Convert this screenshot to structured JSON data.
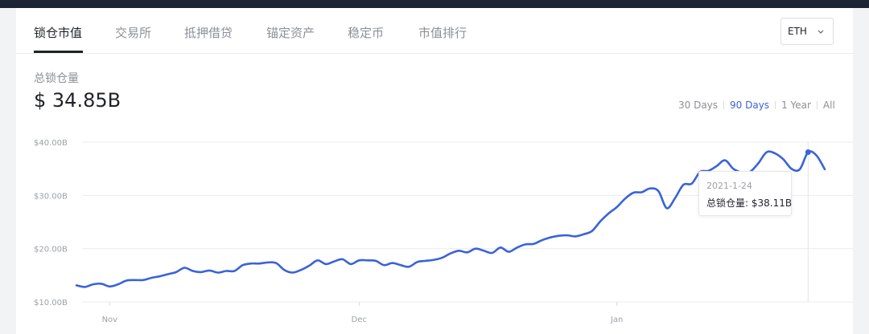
{
  "tabs": [
    "锁仓市值",
    "交易所",
    "抵押借贷",
    "锚定资产",
    "稳定币",
    "市值排行"
  ],
  "currency_select": {
    "value": "ETH"
  },
  "stat": {
    "label": "总锁仓量",
    "value": "$ 34.85B"
  },
  "ranges": [
    "30 Days",
    "90 Days",
    "1 Year",
    "All"
  ],
  "active_range": "90 Days",
  "tooltip": {
    "date": "2021-1-24",
    "label": "总锁仓量:",
    "value": "$38.11B"
  },
  "colors": {
    "line": "#3a63d8",
    "active": "#3a63d8",
    "text": "#1f2329",
    "muted": "#8b8f97"
  },
  "chart_data": {
    "type": "line",
    "x_unit": "date",
    "y_unit": "USD billions",
    "ylim": [
      10,
      40
    ],
    "y_ticks": [
      {
        "value": 10,
        "label": "$10.00B"
      },
      {
        "value": 20,
        "label": "$20.00B"
      },
      {
        "value": 30,
        "label": "$30.00B"
      },
      {
        "value": 40,
        "label": "$40.00B"
      }
    ],
    "x_ticks": [
      {
        "x": "2020-11-01",
        "label": "Nov"
      },
      {
        "x": "2020-12-01",
        "label": "Dec"
      },
      {
        "x": "2021-01-01",
        "label": "Jan"
      }
    ],
    "grid": true,
    "highlight": {
      "x": "2021-01-24",
      "y": 38.11
    },
    "series": [
      {
        "x": [
          "2020-10-28",
          "2020-10-29",
          "2020-10-30",
          "2020-10-31",
          "2020-11-01",
          "2020-11-02",
          "2020-11-03",
          "2020-11-04",
          "2020-11-05",
          "2020-11-06",
          "2020-11-07",
          "2020-11-08",
          "2020-11-09",
          "2020-11-10",
          "2020-11-11",
          "2020-11-12",
          "2020-11-13",
          "2020-11-14",
          "2020-11-15",
          "2020-11-16",
          "2020-11-17",
          "2020-11-18",
          "2020-11-19",
          "2020-11-20",
          "2020-11-21",
          "2020-11-22",
          "2020-11-23",
          "2020-11-24",
          "2020-11-25",
          "2020-11-26",
          "2020-11-27",
          "2020-11-28",
          "2020-11-29",
          "2020-11-30",
          "2020-12-01",
          "2020-12-02",
          "2020-12-03",
          "2020-12-04",
          "2020-12-05",
          "2020-12-06",
          "2020-12-07",
          "2020-12-08",
          "2020-12-09",
          "2020-12-10",
          "2020-12-11",
          "2020-12-12",
          "2020-12-13",
          "2020-12-14",
          "2020-12-15",
          "2020-12-16",
          "2020-12-17",
          "2020-12-18",
          "2020-12-19",
          "2020-12-20",
          "2020-12-21",
          "2020-12-22",
          "2020-12-23",
          "2020-12-24",
          "2020-12-25",
          "2020-12-26",
          "2020-12-27",
          "2020-12-28",
          "2020-12-29",
          "2020-12-30",
          "2020-12-31",
          "2021-01-01",
          "2021-01-02",
          "2021-01-03",
          "2021-01-04",
          "2021-01-05",
          "2021-01-06",
          "2021-01-07",
          "2021-01-08",
          "2021-01-09",
          "2021-01-10",
          "2021-01-11",
          "2021-01-12",
          "2021-01-13",
          "2021-01-14",
          "2021-01-15",
          "2021-01-16",
          "2021-01-17",
          "2021-01-18",
          "2021-01-19",
          "2021-01-20",
          "2021-01-21",
          "2021-01-22",
          "2021-01-23",
          "2021-01-24",
          "2021-01-25",
          "2021-01-26"
        ],
        "y": [
          13.1,
          12.8,
          13.3,
          13.4,
          12.9,
          13.3,
          14.0,
          14.1,
          14.1,
          14.5,
          14.8,
          15.2,
          15.6,
          16.4,
          15.8,
          15.6,
          15.9,
          15.5,
          15.8,
          15.8,
          16.9,
          17.2,
          17.2,
          17.4,
          17.3,
          16.0,
          15.5,
          16.0,
          16.8,
          17.8,
          17.1,
          17.6,
          18.0,
          17.1,
          17.8,
          17.8,
          17.7,
          16.9,
          17.3,
          16.9,
          16.6,
          17.5,
          17.7,
          17.9,
          18.3,
          19.1,
          19.6,
          19.3,
          20.0,
          19.6,
          19.2,
          20.2,
          19.4,
          20.2,
          20.8,
          20.9,
          21.6,
          22.1,
          22.4,
          22.5,
          22.3,
          22.7,
          23.3,
          25.1,
          26.6,
          27.8,
          29.4,
          30.5,
          30.6,
          31.3,
          30.8,
          27.6,
          29.5,
          32.0,
          32.2,
          34.4,
          34.6,
          35.5,
          36.6,
          35.0,
          34.3,
          34.4,
          36.0,
          38.1,
          37.9,
          36.8,
          35.0,
          34.9,
          38.11,
          37.5,
          34.9
        ]
      }
    ]
  }
}
